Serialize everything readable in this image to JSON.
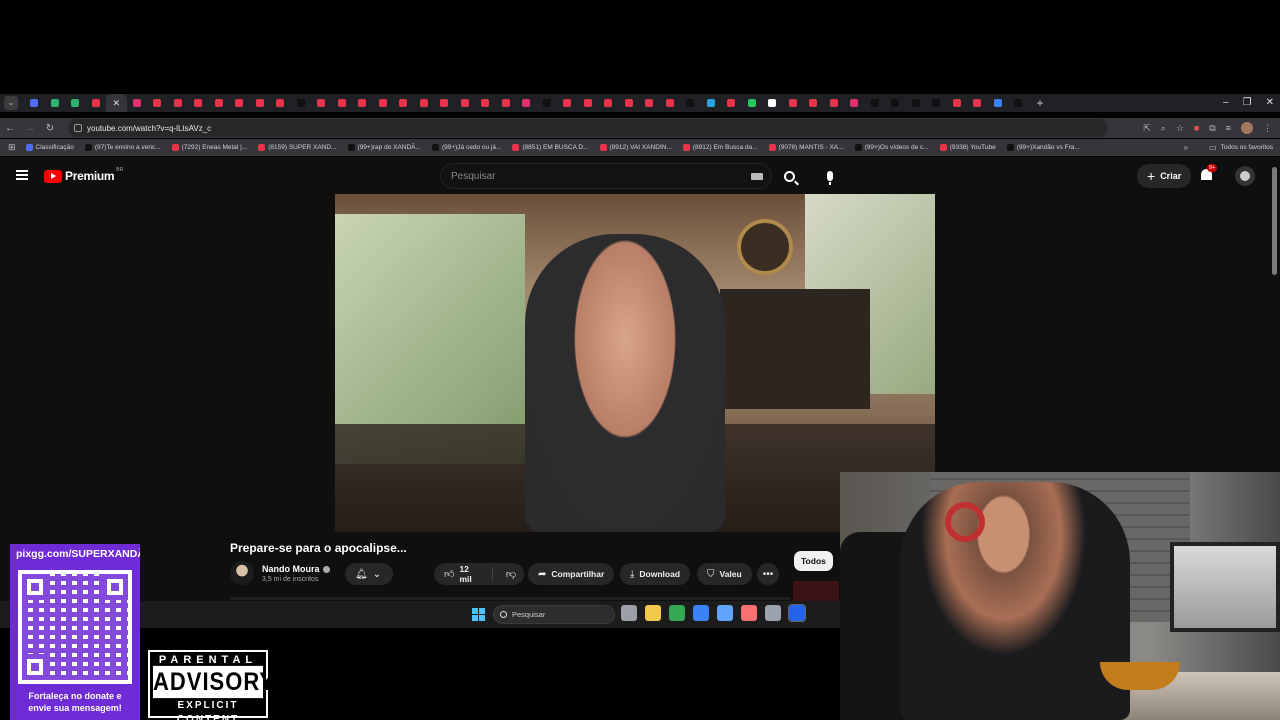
{
  "browser": {
    "url": "youtube.com/watch?v=q-lLtsAVz_c",
    "tab_favicon_colors": [
      "#4c6ef5",
      "#2fb36e",
      "#2fb36e",
      "#e8334a",
      "#ffffff",
      "#e1306c",
      "#e8334a",
      "#e8334a",
      "#e8334a",
      "#e8334a",
      "#e8334a",
      "#e8334a",
      "#e8334a",
      "#111111",
      "#e8334a",
      "#e8334a",
      "#e8334a",
      "#e8334a",
      "#e8334a",
      "#e8334a",
      "#e8334a",
      "#e8334a",
      "#e8334a",
      "#e8334a",
      "#e1306c",
      "#111111",
      "#e8334a",
      "#e8334a",
      "#e8334a",
      "#e8334a",
      "#e8334a",
      "#e8334a",
      "#111111",
      "#2aa3e0",
      "#e8334a",
      "#22c55e",
      "#ffffff",
      "#e8334a",
      "#e8334a",
      "#e8334a",
      "#e1306c",
      "#111111",
      "#111111",
      "#111111",
      "#111111",
      "#e8334a",
      "#e8334a",
      "#3b82f6",
      "#111111"
    ],
    "bookmarks": [
      {
        "label": "Classificação",
        "color": "#4c6ef5"
      },
      {
        "label": "(97)Te ensino a venc...",
        "color": "#111111"
      },
      {
        "label": "(7292) Eneas Metal |...",
        "color": "#e8334a"
      },
      {
        "label": "(8159) SUPER XAND...",
        "color": "#e8334a"
      },
      {
        "label": "(99+)rap do XANDÃ...",
        "color": "#111111"
      },
      {
        "label": "(99+)Já cedo ou já...",
        "color": "#111111"
      },
      {
        "label": "(8851) EM BUSCA D...",
        "color": "#e8334a"
      },
      {
        "label": "(8912) VAI XANDIN...",
        "color": "#e8334a"
      },
      {
        "label": "(8912) Em Busca da...",
        "color": "#e8334a"
      },
      {
        "label": "(9078) MANTIS - XA...",
        "color": "#e8334a"
      },
      {
        "label": "(99+)Os vídeos de c...",
        "color": "#111111"
      },
      {
        "label": "(9338) YouTube",
        "color": "#e8334a"
      },
      {
        "label": "(99+)Xandão vs Fra...",
        "color": "#111111"
      }
    ],
    "all_bookmarks_label": "Todos os favoritos"
  },
  "youtube": {
    "logo_text": "Premium",
    "country_code": "BR",
    "search_placeholder": "Pesquisar",
    "create_label": "Criar",
    "notifications_badge": "9+",
    "video": {
      "title": "Prepare-se para o apocalipse...",
      "channel_name": "Nando Moura",
      "subscribers": "3,5 mi de inscritos",
      "likes": "12 mil",
      "share_label": "Compartilhar",
      "download_label": "Download",
      "thanks_label": "Valeu"
    },
    "filter_chip": "Todos"
  },
  "taskbar": {
    "search_placeholder": "Pesquisar",
    "app_icon_colors": [
      "#9aa0a6",
      "#f2c94c",
      "#34a853",
      "#3b82f6",
      "#60a5fa",
      "#f87171",
      "#9ca3af",
      "#2563eb"
    ]
  },
  "overlay": {
    "pix_url": "pixgg.com/SUPERXANDÃO",
    "qr_caption_line1": "Fortaleça no donate e",
    "qr_caption_line2": "envie sua mensagem!",
    "advisory_top": "PARENTAL",
    "advisory_mid": "ADVISORY",
    "advisory_bottom": "EXPLICIT CONTENT"
  }
}
